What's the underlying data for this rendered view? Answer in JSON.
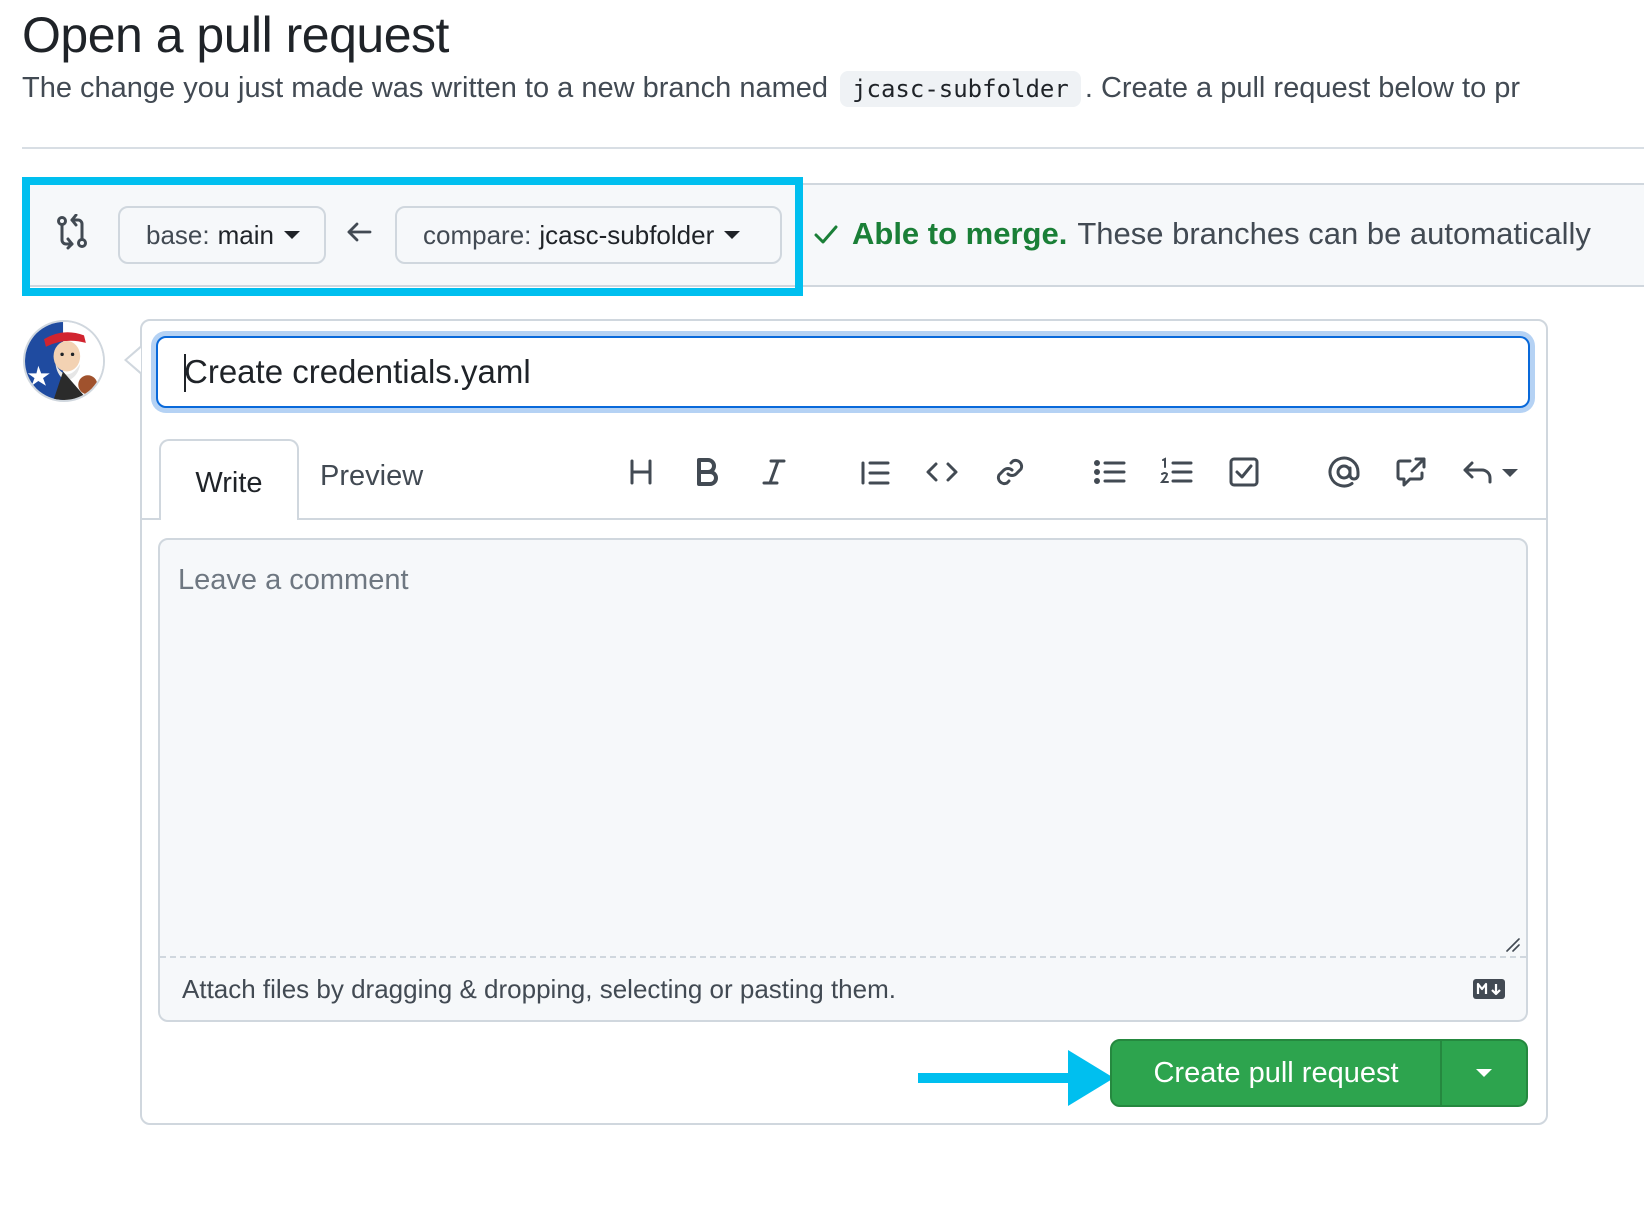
{
  "page": {
    "title": "Open a pull request",
    "subtitle_before": "The change you just made was written to a new branch named",
    "branch_code": "jcasc-subfolder",
    "subtitle_after": ". Create a pull request below to pr"
  },
  "compare": {
    "base_prefix": "base:",
    "base_value": "main",
    "compare_prefix": "compare:",
    "compare_value": "jcasc-subfolder",
    "merge_ok": "Able to merge.",
    "merge_text": "These branches can be automatically"
  },
  "form": {
    "title_value": "Create credentials.yaml",
    "tabs": [
      "Write",
      "Preview"
    ],
    "comment_placeholder": "Leave a comment",
    "attach_text": "Attach files by dragging & dropping, selecting or pasting them.",
    "submit_label": "Create pull request"
  },
  "toolbar": {
    "icons": [
      "heading-icon",
      "bold-icon",
      "italic-icon",
      "quote-icon",
      "code-icon",
      "link-icon",
      "unordered-list-icon",
      "ordered-list-icon",
      "task-list-icon",
      "mention-icon",
      "cross-reference-icon",
      "saved-replies-icon"
    ]
  },
  "colors": {
    "accent": "#0969da",
    "highlight": "#00bfef",
    "success": "#1a7f37",
    "button_green": "#2da44e"
  }
}
